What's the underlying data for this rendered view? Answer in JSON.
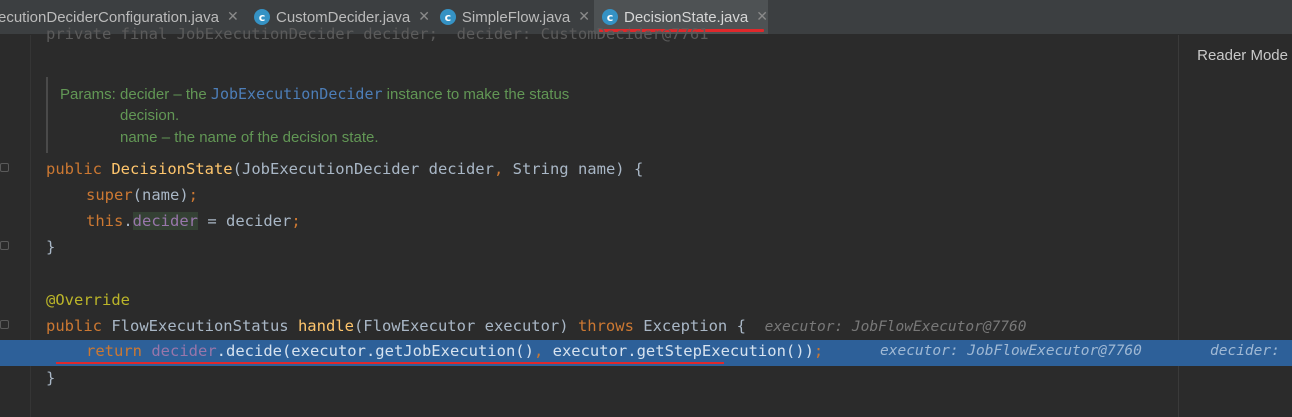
{
  "tabs": [
    {
      "label": "ecutionDeciderConfiguration.java",
      "icon": null,
      "active": false
    },
    {
      "label": "CustomDecider.java",
      "icon": "java-class-icon",
      "active": false
    },
    {
      "label": "SimpleFlow.java",
      "icon": "java-class-icon",
      "active": false
    },
    {
      "label": "DecisionState.java",
      "icon": "java-class-icon",
      "active": true
    }
  ],
  "reader_mode": "Reader Mode",
  "ghost_line": "private final JobExecutionDecider decider;  decider: CustomDecider@7761",
  "doc": {
    "params_prefix": "Params: decider – the ",
    "params_link": "JobExecutionDecider",
    "params_suffix": " instance to make the status",
    "line2": "decision.",
    "line3": "name – the name of the decision state."
  },
  "code": {
    "l1_public": "public ",
    "l1_name": "DecisionState",
    "l1_rest": "(JobExecutionDecider decider",
    "l1_comma": ", ",
    "l1_rest2": "String name) {",
    "l2_super": "super",
    "l2_rest": "(name)",
    "l2_semi": ";",
    "l3_this": "this",
    "l3_dot": ".",
    "l3_field": "decider",
    "l3_rest": " = decider",
    "l3_semi": ";",
    "l4": "}",
    "l5": "@Override",
    "l6_public": "public ",
    "l6_type": "FlowExecutionStatus ",
    "l6_name": "handle",
    "l6_rest": "(FlowExecutor executor) ",
    "l6_throws": "throws ",
    "l6_exc": "Exception {",
    "l6_inlay": "executor: JobFlowExecutor@7760",
    "l7_return": "return ",
    "l7_field": "decider",
    "l7_rest": ".decide(executor.getJobExecution()",
    "l7_comma": ", ",
    "l7_rest2": "executor.getStepExecution())",
    "l7_semi": ";",
    "l7_inlay1": "executor: JobFlowExecutor@7760",
    "l7_inlay2": "decider: ",
    "l8": "}"
  },
  "colors": {
    "editor_bg": "#2b2b2b",
    "highlight": "#2d6099",
    "keyword": "#cc7832",
    "method": "#ffc66d",
    "field": "#9876aa",
    "annotation": "#bbb529",
    "doc": "#629755",
    "underline": "#e0282b"
  }
}
